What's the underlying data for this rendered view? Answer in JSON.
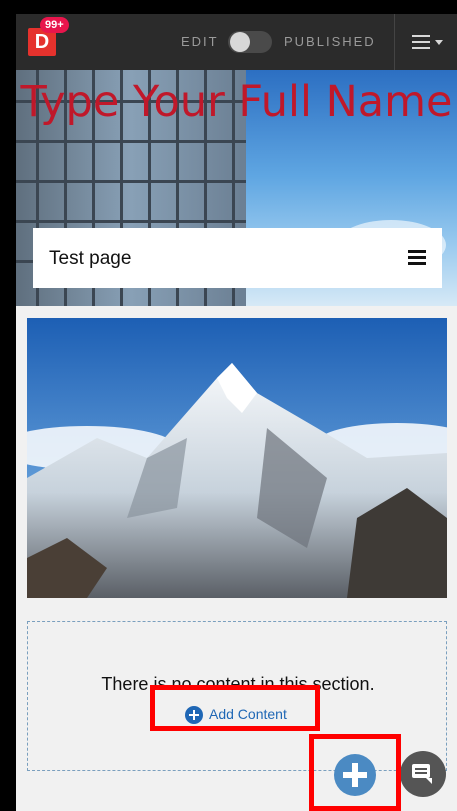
{
  "topbar": {
    "logo_letter": "D",
    "notification_badge": "99+",
    "edit_label": "EDIT",
    "published_label": "PUBLISHED",
    "toggle_state": "edit"
  },
  "hero": {
    "title": "Type Your Full Name",
    "title_color": "#c0182a",
    "page_title": "Test page"
  },
  "content": {
    "image_icon": "mountain-photo",
    "empty_message": "There is no content in this section.",
    "add_content_label": "Add Content"
  },
  "accent_color": "#1f67b5",
  "highlight_color": "#ff0000"
}
